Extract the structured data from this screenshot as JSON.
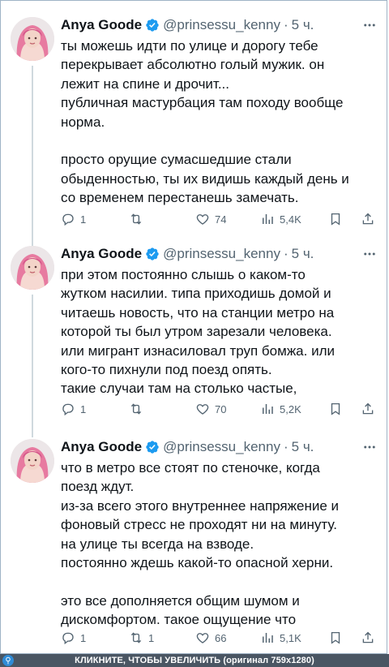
{
  "tweets": [
    {
      "author": "Anya Goode",
      "handle": "@prinsessu_kenny",
      "time": "5 ч.",
      "lines": [
        "ты можешь идти по улице и дорогу тебе",
        "перекрывает абсолютно голый мужик. он",
        "лежит на спине и дрочит...",
        "публичная мастурбация там походу вообще",
        "норма.",
        "",
        "просто орущие сумасшедшие стали",
        "обыденностью, ты их видишь каждый день и",
        "со временем перестанешь замечать."
      ],
      "replies": "1",
      "reposts": "",
      "likes": "74",
      "views": "5,4K"
    },
    {
      "author": "Anya Goode",
      "handle": "@prinsessu_kenny",
      "time": "5 ч.",
      "lines": [
        "при этом постоянно слышь о каком-то",
        "жутком насилии. типа приходишь домой и",
        "читаешь новость, что на станции метро на",
        "которой ты был утром зарезали человека.",
        "или мигрант изнасиловал труп бомжа. или",
        "кого-то пихнули под поезд опять.",
        "такие случаи там на столько частые,"
      ],
      "replies": "1",
      "reposts": "",
      "likes": "70",
      "views": "5,2K"
    },
    {
      "author": "Anya Goode",
      "handle": "@prinsessu_kenny",
      "time": "5 ч.",
      "lines": [
        "что в метро все стоят по стеночке, когда",
        "поезд ждут.",
        "из-за всего этого внутреннее напряжение и",
        "фоновый стресс не проходят ни на минуту.",
        "на улице ты всегда на взводе.",
        "постоянно ждешь какой-то опасной херни.",
        "",
        "это все дополняется общим шумом и",
        "дискомфортом. такое ощущение что"
      ],
      "replies": "1",
      "reposts": "1",
      "likes": "66",
      "views": "5,1K"
    }
  ],
  "icons": {
    "verified": "verified-badge-icon",
    "more": "more-dots-icon",
    "reply": "reply-icon",
    "repost": "repost-icon",
    "like": "like-icon",
    "views": "views-icon",
    "bookmark": "bookmark-icon",
    "share": "share-icon"
  },
  "colors": {
    "verified": "#1d9bf0",
    "muted": "#536471",
    "thread_line": "#cfd9de"
  },
  "bottom_bar": {
    "caption": "КЛИКНИТЕ, ЧТОБЫ УВЕЛИЧИТЬ (оригинал 759x1280)"
  }
}
